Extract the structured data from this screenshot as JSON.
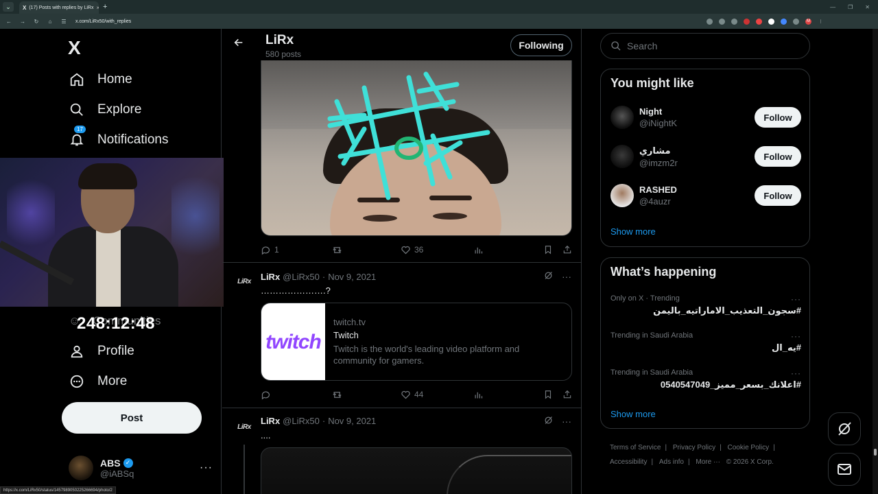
{
  "browser": {
    "tab_title": "(17) Posts with replies by LiRx",
    "url": "x.com/LiRx50/with_replies",
    "status_url": "https://x.com/LiRx50/status/1457989050225266694/photo/2"
  },
  "sidebar": {
    "logo": "X",
    "nav": [
      {
        "label": "Home",
        "icon": "home-icon"
      },
      {
        "label": "Explore",
        "icon": "search-icon"
      },
      {
        "label": "Notifications",
        "icon": "bell-icon",
        "badge": "17"
      },
      {
        "label": "Communities",
        "icon": "people-icon"
      },
      {
        "label": "Profile",
        "icon": "person-icon"
      },
      {
        "label": "More",
        "icon": "more-circle-icon"
      }
    ],
    "timer": "248:12:48",
    "post_label": "Post",
    "account": {
      "name": "ABS",
      "handle": "@iABSq"
    }
  },
  "profile_header": {
    "name": "LiRx",
    "post_count": "580 posts",
    "following_label": "Following"
  },
  "tweets": [
    {
      "actions": {
        "replies": "1",
        "retweets": "",
        "likes": "36"
      }
    },
    {
      "avatar_text": "LiRx",
      "name": "LiRx",
      "handle": "@LiRx50",
      "date": "Nov 9, 2021",
      "text": "………………….?",
      "card": {
        "logo": "twitch",
        "domain": "twitch.tv",
        "title": "Twitch",
        "description": "Twitch is the world's leading video platform and community for gamers."
      },
      "actions": {
        "replies": "",
        "retweets": "",
        "likes": "44"
      }
    },
    {
      "avatar_text": "LiRx",
      "name": "LiRx",
      "handle": "@LiRx50",
      "date": "Nov 9, 2021",
      "text": "...."
    }
  ],
  "search": {
    "placeholder": "Search"
  },
  "you_might_like": {
    "title": "You might like",
    "users": [
      {
        "name": "Night",
        "handle": "@iNightK",
        "button": "Follow"
      },
      {
        "name": "مشاري",
        "handle": "@imzm2r",
        "button": "Follow"
      },
      {
        "name": "RASHED",
        "handle": "@4auzr",
        "button": "Follow"
      }
    ],
    "show_more": "Show more"
  },
  "whats_happening": {
    "title": "What’s happening",
    "trends": [
      {
        "context": "Only on X · Trending",
        "name": "#سجون_التعذيب_الاماراتيه_باليمن"
      },
      {
        "context": "Trending in Saudi Arabia",
        "name": "#يه_ال"
      },
      {
        "context": "Trending in Saudi Arabia",
        "name": "#اعلانك_بسعر_مميز_0540547049"
      }
    ],
    "show_more": "Show more"
  },
  "footer": {
    "links": [
      "Terms of Service",
      "Privacy Policy",
      "Cookie Policy",
      "Accessibility",
      "Ads info",
      "More ···"
    ],
    "copyright": "© 2026 X Corp."
  },
  "colors": {
    "accent": "#1d9bf0",
    "background": "#000000",
    "border": "#2f3336",
    "twitch": "#9146ff",
    "drawing": "#3fe0d8"
  }
}
